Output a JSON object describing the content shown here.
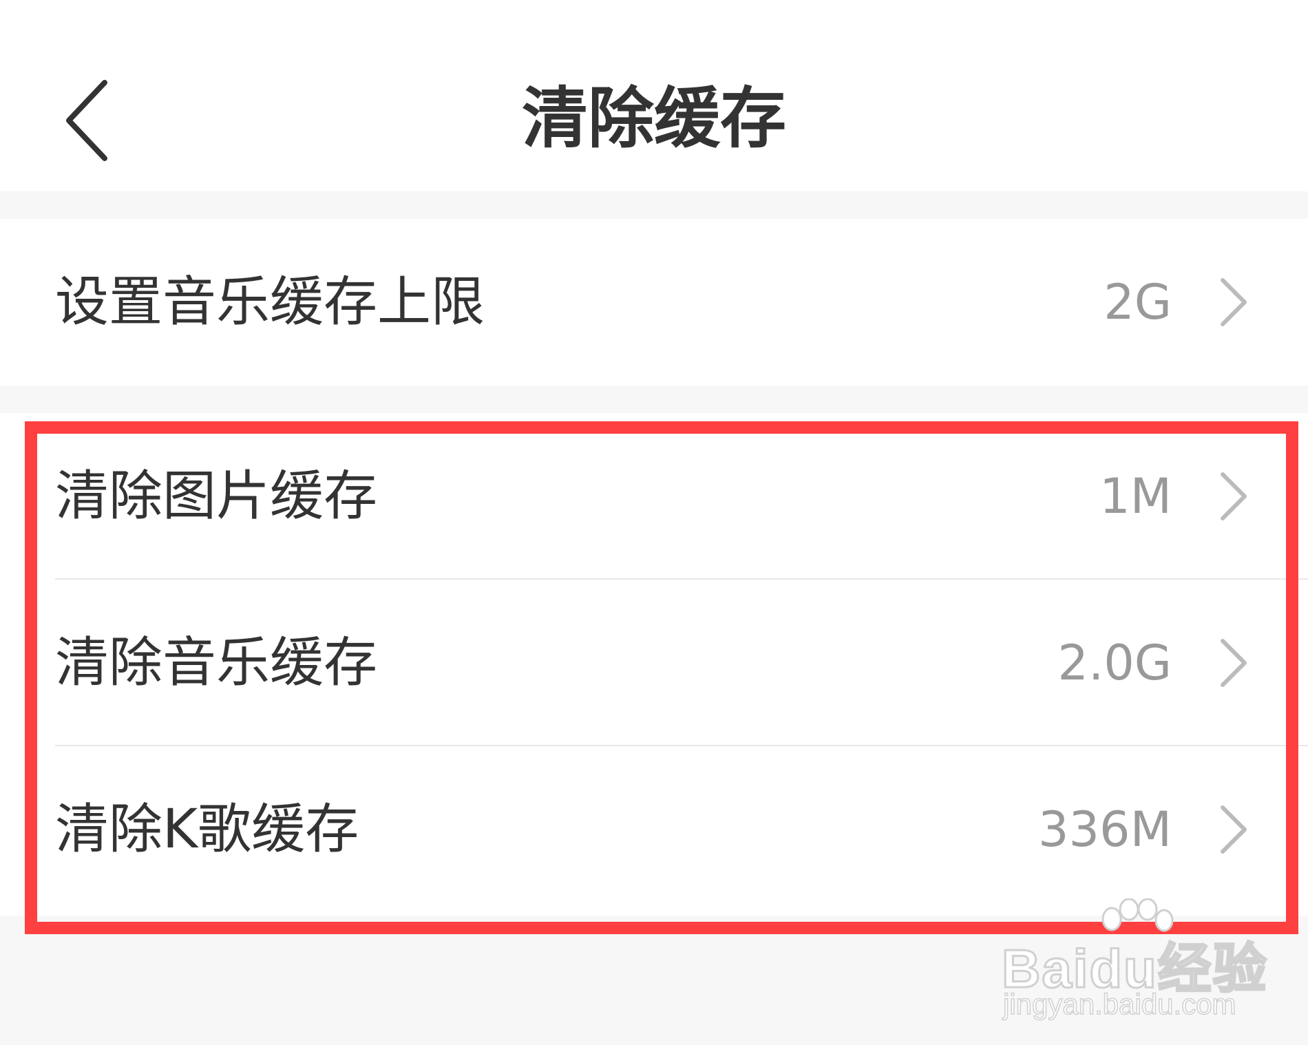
{
  "header": {
    "title": "清除缓存",
    "back_icon": "chevron-left-icon"
  },
  "cache_limit": {
    "label": "设置音乐缓存上限",
    "value": "2G",
    "icon": "chevron-right-icon"
  },
  "cache_items": [
    {
      "label": "清除图片缓存",
      "value": "1M",
      "icon": "chevron-right-icon"
    },
    {
      "label": "清除音乐缓存",
      "value": "2.0G",
      "icon": "chevron-right-icon"
    },
    {
      "label": "清除K歌缓存",
      "value": "336M",
      "icon": "chevron-right-icon"
    }
  ],
  "watermark": {
    "brand": "Baidu经验",
    "url": "jingyan.baidu.com"
  },
  "colors": {
    "highlight_border": "#ff4040",
    "page_background": "#f7f7f7",
    "primary_text": "#333333",
    "secondary_text": "#999999"
  }
}
